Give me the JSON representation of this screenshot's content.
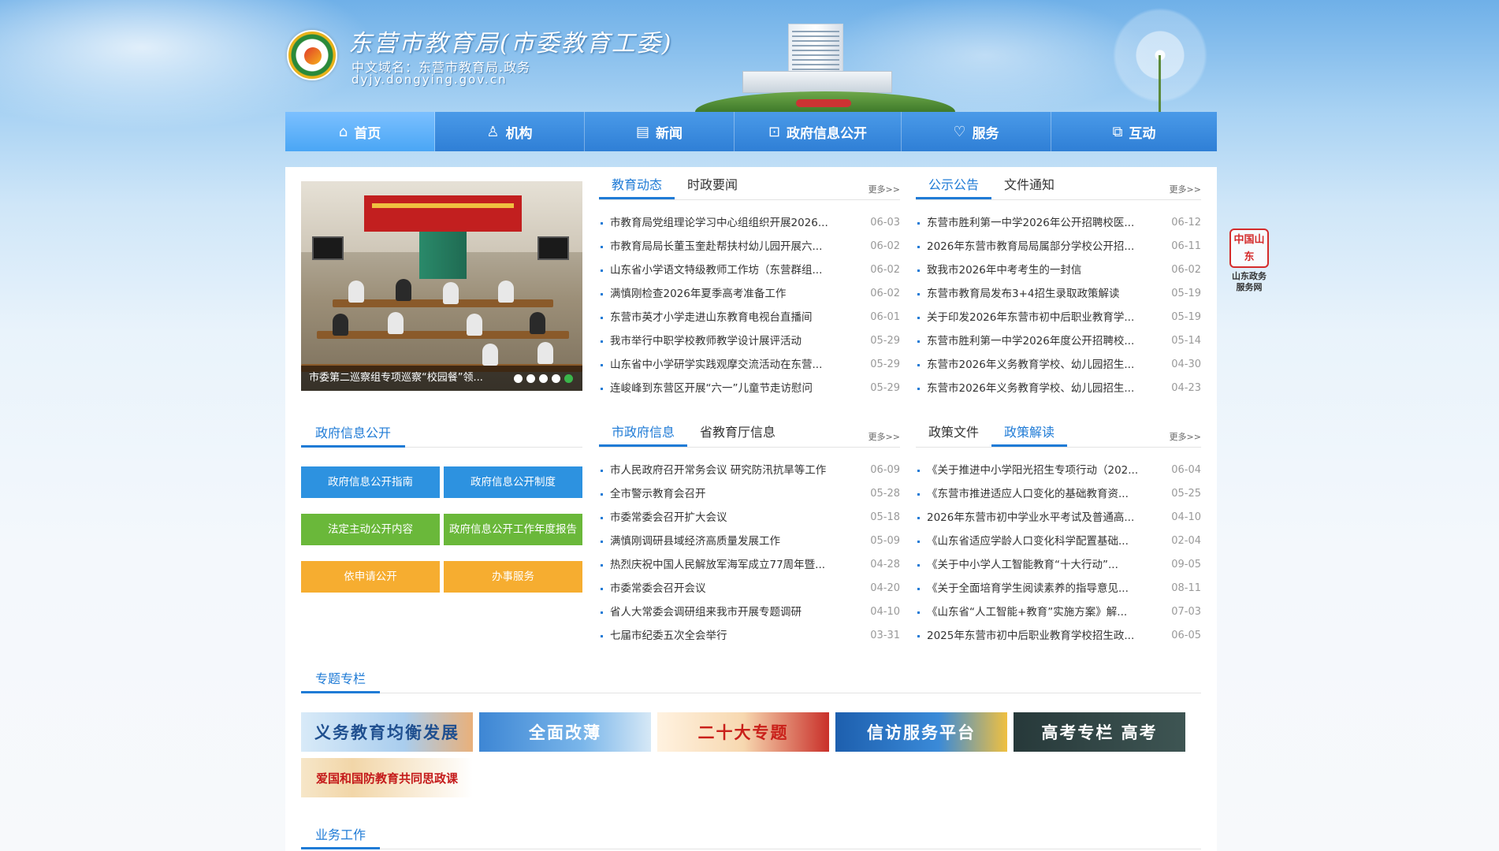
{
  "header": {
    "title": "东营市教育局(市委教育工委)",
    "domain_cn": "中文域名：东营市教育局.政务",
    "url": "dyjy.dongying.gov.cn"
  },
  "nav": [
    {
      "label": "首页",
      "icon": "home-icon",
      "glyph": "⌂"
    },
    {
      "label": "机构",
      "icon": "org-chart-icon",
      "glyph": "♙"
    },
    {
      "label": "新闻",
      "icon": "newspaper-icon",
      "glyph": "▤"
    },
    {
      "label": "政府信息公开",
      "icon": "lock-icon",
      "glyph": "⊡"
    },
    {
      "label": "服务",
      "icon": "heart-icon",
      "glyph": "♡"
    },
    {
      "label": "互动",
      "icon": "interact-icon",
      "glyph": "⧉"
    }
  ],
  "slide": {
    "caption": "市委第二巡察组专项巡察“校园餐”领..."
  },
  "news": {
    "tabs": [
      "教育动态",
      "时政要闻"
    ],
    "more": "更多>>",
    "items": [
      {
        "title": "市教育局党组理论学习中心组组织开展2026...",
        "date": "06-03"
      },
      {
        "title": "市教育局局长董玉奎赴帮扶村幼儿园开展六...",
        "date": "06-02"
      },
      {
        "title": "山东省小学语文特级教师工作坊（东营群组...",
        "date": "06-02"
      },
      {
        "title": "满慎刚检查2026年夏季高考准备工作",
        "date": "06-02"
      },
      {
        "title": "东营市英才小学走进山东教育电视台直播间",
        "date": "06-01"
      },
      {
        "title": "我市举行中职学校教师教学设计展评活动",
        "date": "05-29"
      },
      {
        "title": "山东省中小学研学实践观摩交流活动在东营...",
        "date": "05-29"
      },
      {
        "title": "连峻峰到东营区开展“六一”儿童节走访慰问",
        "date": "05-29"
      }
    ]
  },
  "notices": {
    "tabs": [
      "公示公告",
      "文件通知"
    ],
    "more": "更多>>",
    "items": [
      {
        "title": "东营市胜利第一中学2026年公开招聘校医...",
        "date": "06-12"
      },
      {
        "title": "2026年东营市教育局局属部分学校公开招...",
        "date": "06-11"
      },
      {
        "title": "致我市2026年中考考生的一封信",
        "date": "06-02"
      },
      {
        "title": "东营市教育局发布3+4招生录取政策解读",
        "date": "05-19"
      },
      {
        "title": "关于印发2026年东营市初中后职业教育学...",
        "date": "05-19"
      },
      {
        "title": "东营市胜利第一中学2026年度公开招聘校...",
        "date": "05-14"
      },
      {
        "title": "东营市2026年义务教育学校、幼儿园招生...",
        "date": "04-30"
      },
      {
        "title": "东营市2026年义务教育学校、幼儿园招生...",
        "date": "04-23"
      }
    ]
  },
  "gov_info": {
    "title": "政府信息公开",
    "buttons": [
      "政府信息公开指南",
      "政府信息公开制度",
      "法定主动公开内容",
      "政府信息公开工作年度报告",
      "依申请公开",
      "办事服务"
    ]
  },
  "city_info": {
    "tabs": [
      "市政府信息",
      "省教育厅信息"
    ],
    "more": "更多>>",
    "items": [
      {
        "title": "市人民政府召开常务会议 研究防汛抗旱等工作",
        "date": "06-09"
      },
      {
        "title": "全市警示教育会召开",
        "date": "05-28"
      },
      {
        "title": "市委常委会召开扩大会议",
        "date": "05-18"
      },
      {
        "title": "满慎刚调研县域经济高质量发展工作",
        "date": "05-09"
      },
      {
        "title": "热烈庆祝中国人民解放军海军成立77周年暨...",
        "date": "04-28"
      },
      {
        "title": "市委常委会召开会议",
        "date": "04-20"
      },
      {
        "title": "省人大常委会调研组来我市开展专题调研",
        "date": "04-10"
      },
      {
        "title": "七届市纪委五次全会举行",
        "date": "03-31"
      }
    ]
  },
  "policy": {
    "tabs": [
      "政策文件",
      "政策解读"
    ],
    "more": "更多>>",
    "items": [
      {
        "title": "《关于推进中小学阳光招生专项行动（202...",
        "date": "06-04"
      },
      {
        "title": "《东营市推进适应人口变化的基础教育资...",
        "date": "05-25"
      },
      {
        "title": "2026年东营市初中学业水平考试及普通高...",
        "date": "04-10"
      },
      {
        "title": "《山东省适应学龄人口变化科学配置基础...",
        "date": "02-04"
      },
      {
        "title": "《关于中小学人工智能教育“十大行动”...",
        "date": "09-05"
      },
      {
        "title": "《关于全面培育学生阅读素养的指导意见...",
        "date": "08-11"
      },
      {
        "title": "《山东省“人工智能+教育”实施方案》解...",
        "date": "07-03"
      },
      {
        "title": "2025年东营市初中后职业教育学校招生政...",
        "date": "06-05"
      }
    ]
  },
  "topics": {
    "title": "专题专栏",
    "items": [
      "义务教育均衡发展",
      "全面改薄",
      "二十大专题",
      "信访服务平台",
      "高考专栏 高考",
      "爱国和国防教育共同思政课"
    ]
  },
  "business": {
    "title": "业务工作"
  },
  "side_badge": {
    "seal": "中国山东",
    "label": "山东政务服务网"
  },
  "colors": {
    "nav": "#2f7fd6",
    "accent": "#1f7bd6",
    "btn_blue": "#2d92e0",
    "btn_green": "#6ab83a",
    "btn_orange": "#f6ad30"
  }
}
